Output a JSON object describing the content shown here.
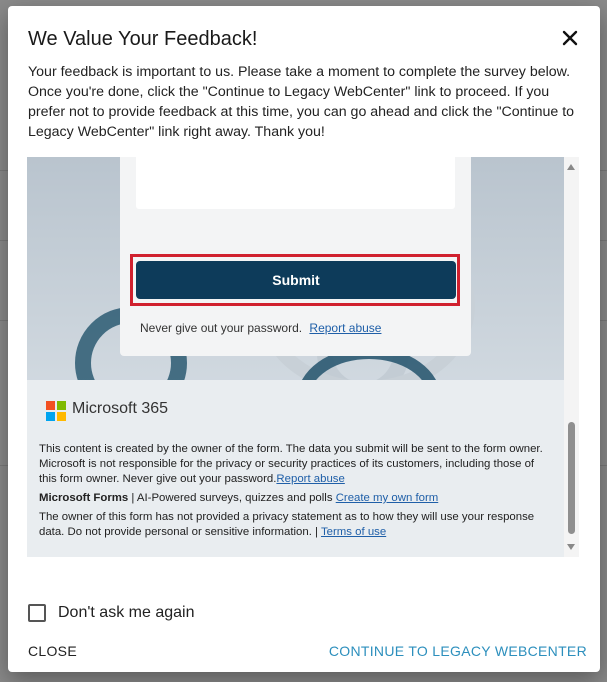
{
  "dialog": {
    "title": "We Value Your Feedback!",
    "intro": "Your feedback is important to us. Please take a moment to complete the survey below. Once you're done, click the \"Continue to Legacy WebCenter\" link to proceed. If you prefer not to provide feedback at this time, you can go ahead and click the \"Continue to Legacy WebCenter\" link right away. Thank you!",
    "close_icon": "close-icon"
  },
  "form": {
    "submit_label": "Submit",
    "password_note": "Never give out your password.",
    "report_abuse": "Report abuse"
  },
  "footer": {
    "brand": "Microsoft 365",
    "disclaimer": "This content is created by the owner of the form. The data you submit will be sent to the form owner. Microsoft is not responsible for the privacy or security practices of its customers, including those of this form owner. Never give out your password.",
    "report_abuse": "Report abuse",
    "forms_brand": "Microsoft Forms",
    "forms_tagline": " | AI-Powered surveys, quizzes and polls ",
    "create_form": "Create my own form",
    "privacy_text": "The owner of this form has not provided a privacy statement as to how they will use your response data. Do not provide personal or sensitive information. | ",
    "terms": "Terms of use",
    "logo_colors": [
      "#f25022",
      "#7fba00",
      "#00a4ef",
      "#ffb900"
    ]
  },
  "actions": {
    "dont_ask_label": "Don't ask me again",
    "close_label": "CLOSE",
    "continue_label": "CONTINUE TO LEGACY WEBCENTER"
  },
  "colors": {
    "submit": "#0d3b5a",
    "highlight": "#d0202e",
    "continue": "#2c8fbd"
  }
}
